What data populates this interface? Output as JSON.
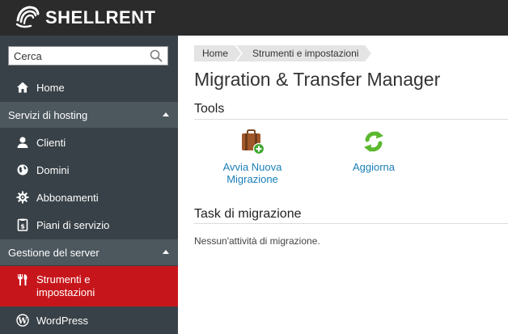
{
  "header": {
    "brand": "SHELLRENT",
    "logo_icon": "shell-logo-icon"
  },
  "sidebar": {
    "search_placeholder": "Cerca",
    "home_label": "Home",
    "sections": [
      {
        "title": "Servizi di hosting",
        "items": [
          {
            "label": "Clienti",
            "icon": "user-icon"
          },
          {
            "label": "Domini",
            "icon": "globe-icon"
          },
          {
            "label": "Abbonamenti",
            "icon": "gear-icon"
          },
          {
            "label": "Piani di servizio",
            "icon": "plan-icon"
          }
        ]
      },
      {
        "title": "Gestione del server",
        "items": [
          {
            "label_line1": "Strumenti e",
            "label_line2": "impostazioni",
            "icon": "tools-icon",
            "active": true
          },
          {
            "label": "WordPress",
            "icon": "wordpress-icon"
          }
        ]
      }
    ]
  },
  "breadcrumb": [
    "Home",
    "Strumenti e impostazioni"
  ],
  "main": {
    "title": "Migration & Transfer Manager",
    "tools_heading": "Tools",
    "tools": [
      {
        "label_line1": "Avvia Nuova",
        "label_line2": "Migrazione",
        "icon": "suitcase-add-icon"
      },
      {
        "label": "Aggiorna",
        "icon": "refresh-icon"
      }
    ],
    "tasks_heading": "Task di migrazione",
    "tasks_empty": "Nessun'attività di migrazione."
  },
  "colors": {
    "topbar": "#2b2b2b",
    "sidebar": "#384147",
    "section": "#4c575e",
    "active": "#c7161b",
    "link": "#1a7fb8"
  }
}
